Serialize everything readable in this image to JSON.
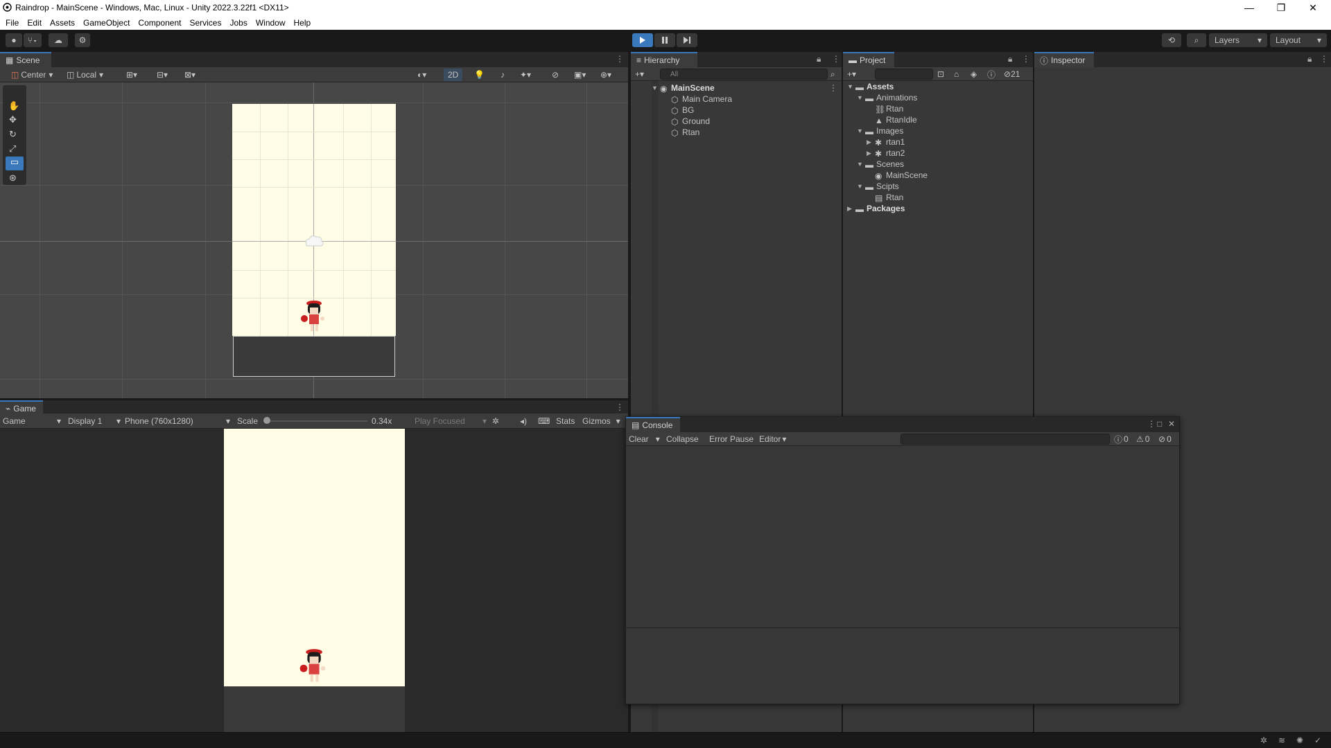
{
  "window": {
    "title": "Raindrop - MainScene - Windows, Mac, Linux - Unity 2022.3.22f1 <DX11>",
    "minimize": "—",
    "maximize": "❐",
    "close": "✕"
  },
  "menu": [
    "File",
    "Edit",
    "Assets",
    "GameObject",
    "Component",
    "Services",
    "Jobs",
    "Window",
    "Help"
  ],
  "toolbar": {
    "layers_label": "Layers",
    "layout_label": "Layout"
  },
  "scene": {
    "tab": "Scene",
    "pivot": "Center",
    "space": "Local",
    "mode_2d": "2D"
  },
  "game": {
    "tab": "Game",
    "view": "Game",
    "display": "Display 1",
    "resolution": "Phone (760x1280)",
    "scale_label": "Scale",
    "scale_value": "0.34x",
    "play_focused": "Play Focused",
    "stats": "Stats",
    "gizmos": "Gizmos"
  },
  "hierarchy": {
    "tab": "Hierarchy",
    "search_placeholder": "All",
    "scene": "MainScene",
    "items": [
      "Main Camera",
      "BG",
      "Ground",
      "Rtan"
    ]
  },
  "project": {
    "tab": "Project",
    "hidden_count": "21",
    "assets": "Assets",
    "animations": "Animations",
    "anim_items": [
      "Rtan",
      "RtanIdle"
    ],
    "images": "Images",
    "image_items": [
      "rtan1",
      "rtan2"
    ],
    "scenes": "Scenes",
    "scene_items": [
      "MainScene"
    ],
    "scripts": "Scipts",
    "script_items": [
      "Rtan"
    ],
    "packages": "Packages"
  },
  "inspector": {
    "tab": "Inspector"
  },
  "console": {
    "tab": "Console",
    "clear": "Clear",
    "collapse": "Collapse",
    "error_pause": "Error Pause",
    "editor": "Editor",
    "info_count": "0",
    "warn_count": "0",
    "error_count": "0"
  },
  "colors": {
    "bg_canvas": "#fffde6",
    "accent": "#3a79bb",
    "ground": "#3a3a3a"
  }
}
